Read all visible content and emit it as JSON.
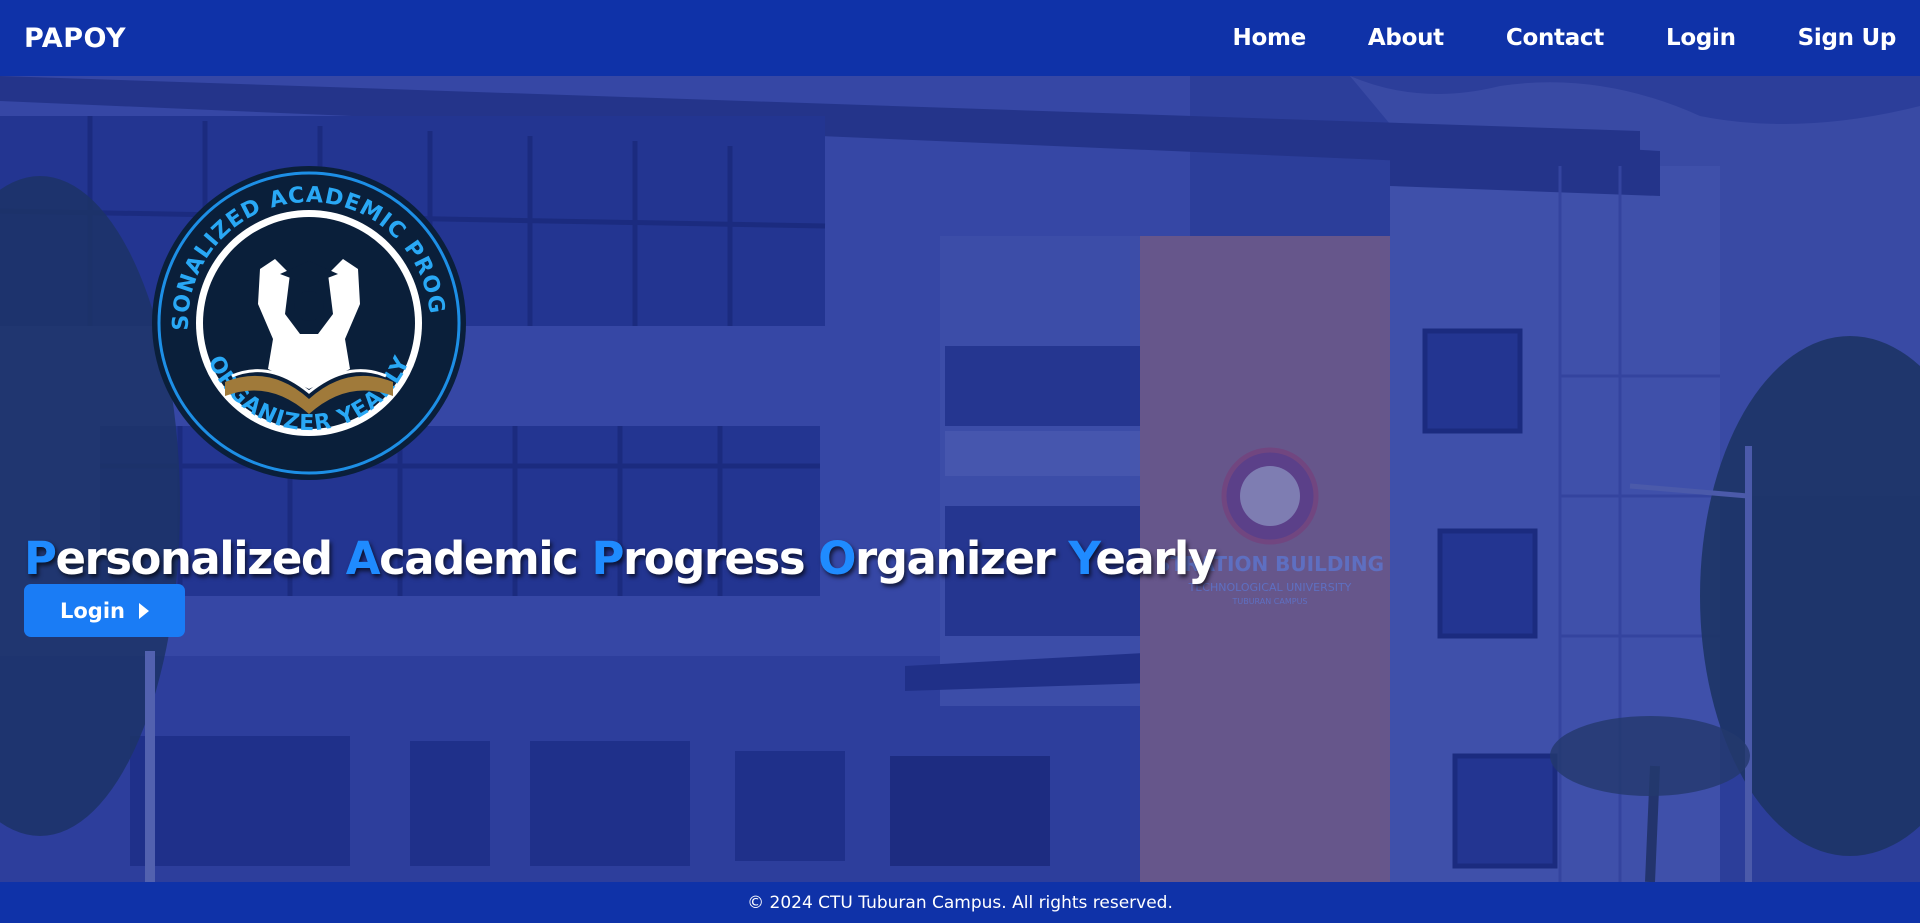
{
  "nav": {
    "brand": "PAPOY",
    "links": [
      "Home",
      "About",
      "Contact",
      "Login",
      "Sign Up"
    ]
  },
  "hero": {
    "emblem_top_text": "PERSONALIZED ACADEMIC PROGRESS",
    "emblem_bottom_text": "ORGANIZER YEARLY",
    "building_sign": "STRATION BUILDING",
    "building_sign_sub": "TECHNOLOGICAL UNIVERSITY",
    "building_sign_sub2": "TUBURAN CAMPUS",
    "tagline_words": [
      {
        "initial": "P",
        "rest": "ersonalized"
      },
      {
        "initial": "A",
        "rest": "cademic"
      },
      {
        "initial": "P",
        "rest": "rogress"
      },
      {
        "initial": "O",
        "rest": "rganizer"
      },
      {
        "initial": "Y",
        "rest": "early"
      }
    ],
    "cta_label": "Login"
  },
  "footer": {
    "text": "© 2024 CTU Tuburan Campus. All rights reserved."
  },
  "colors": {
    "primary": "#0f32a8",
    "accent": "#1a7cf5",
    "highlight": "#1f8bff"
  }
}
